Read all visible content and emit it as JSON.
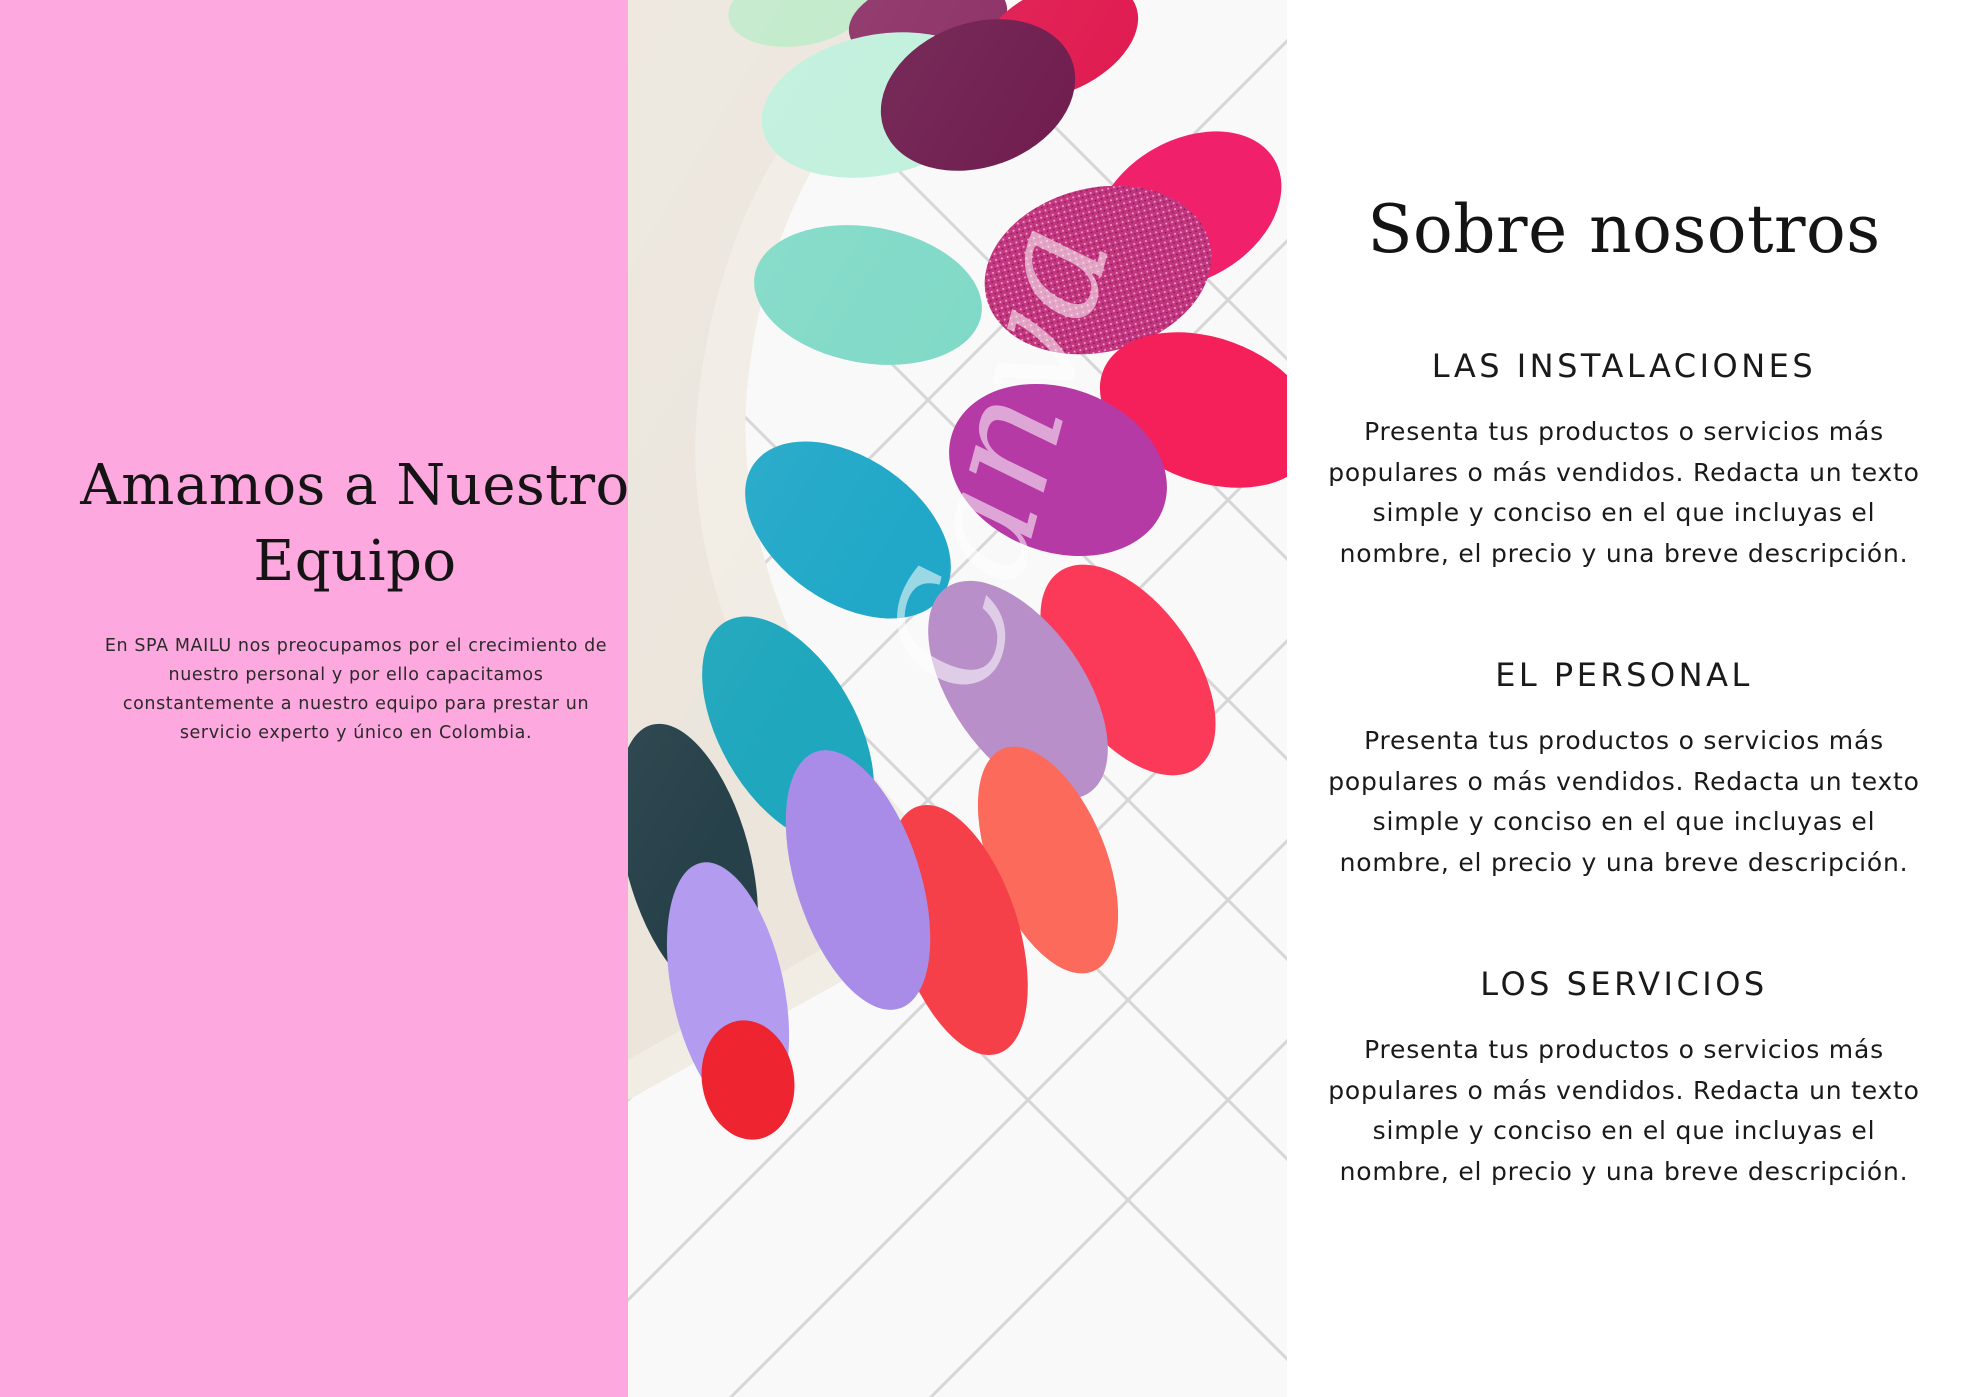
{
  "left_panel": {
    "title": "Amamos a Nuestro Equipo",
    "body": "En SPA MAILU nos preocupamos por el crecimiento de nuestro personal y por ello capacitamos constantemente a nuestro equipo para prestar un servicio experto y único en Colombia.",
    "background_color": "#fda8de"
  },
  "photo": {
    "subject": "painted nail tips fan on white tile background",
    "watermark": "Canva"
  },
  "right_column": {
    "title": "Sobre nosotros",
    "sections": [
      {
        "heading": "LAS INSTALACIONES",
        "body": "Presenta tus productos o servicios más populares o más vendidos. Redacta un texto simple y conciso en el que incluyas el nombre, el precio y una breve descripción."
      },
      {
        "heading": "EL PERSONAL",
        "body": "Presenta tus productos o servicios más populares o más vendidos. Redacta un texto simple y conciso en el que incluyas el nombre, el precio y una breve descripción."
      },
      {
        "heading": "LOS SERVICIOS",
        "body": "Presenta tus productos o servicios más populares o más vendidos. Redacta un texto simple y conciso en el que incluyas el nombre, el precio y una breve descripción."
      }
    ]
  }
}
